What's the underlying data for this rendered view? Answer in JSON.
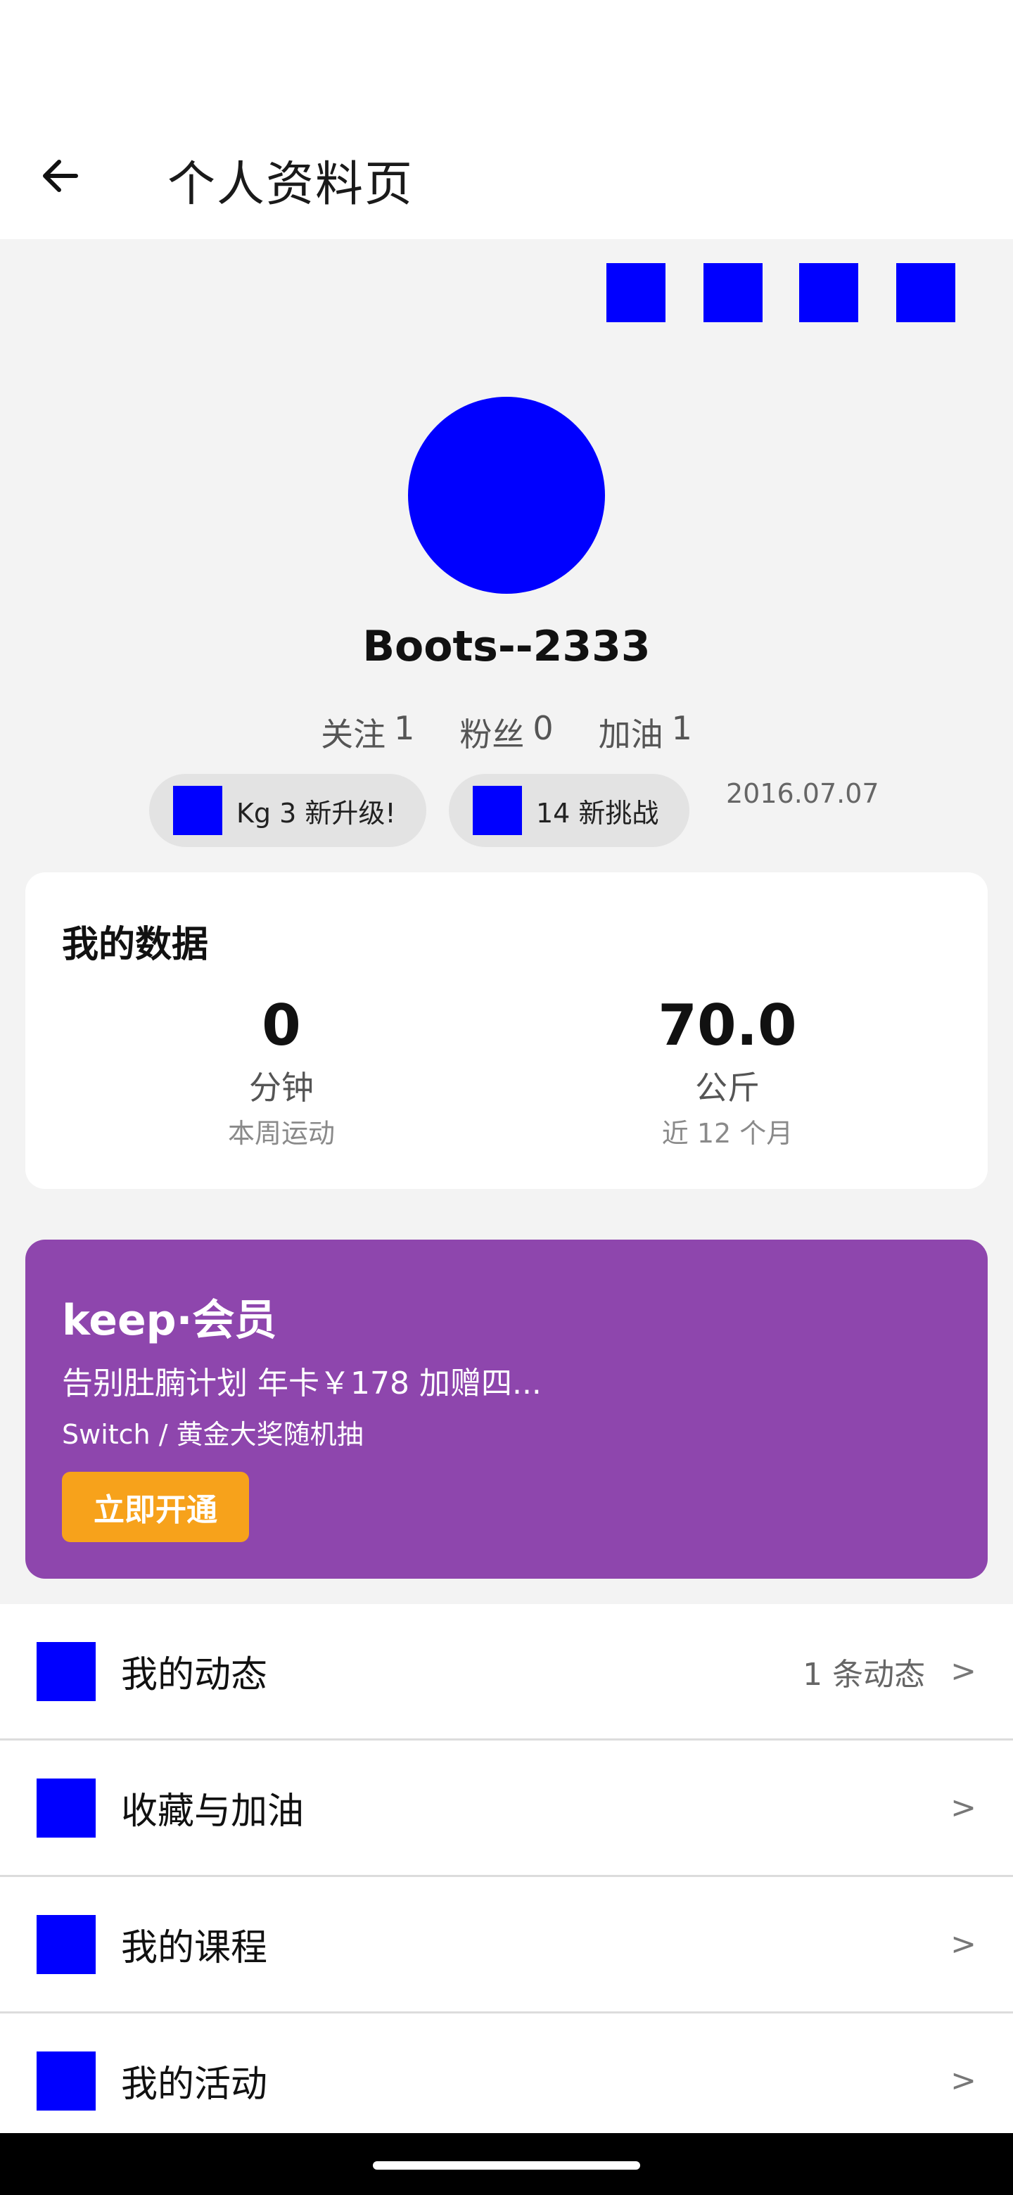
{
  "header": {
    "title": "个人资料页"
  },
  "profile": {
    "username": "Boots--2333",
    "stats": [
      {
        "label": "关注",
        "value": "1"
      },
      {
        "label": "粉丝",
        "value": "0"
      },
      {
        "label": "加油",
        "value": "1"
      }
    ],
    "chips": [
      {
        "text": "Kg 3 新升级!"
      },
      {
        "text": "14 新挑战"
      }
    ],
    "join_date": "2016.07.07"
  },
  "my_data": {
    "title": "我的数据",
    "metrics": [
      {
        "value": "0",
        "unit": "分钟",
        "desc": "本周运动"
      },
      {
        "value": "70.0",
        "unit": "公斤",
        "desc": "近 12 个月"
      }
    ]
  },
  "member": {
    "title": "keep·会员",
    "line1": "告别肚腩计划 年卡￥178 加赠四...",
    "line2": "Switch / 黄金大奖随机抽",
    "button": "立即开通",
    "color": "#8e46ad",
    "button_color": "#f7a21b"
  },
  "menu": [
    {
      "label": "我的动态",
      "meta": "1 条动态",
      "chevron": ">"
    },
    {
      "label": "收藏与加油",
      "meta": "",
      "chevron": ">"
    },
    {
      "label": "我的课程",
      "meta": "",
      "chevron": ">"
    },
    {
      "label": "我的活动",
      "meta": "",
      "chevron": ">"
    }
  ],
  "icons": {
    "back": "arrow-left-icon",
    "placeholder_color": "#0000ff"
  }
}
